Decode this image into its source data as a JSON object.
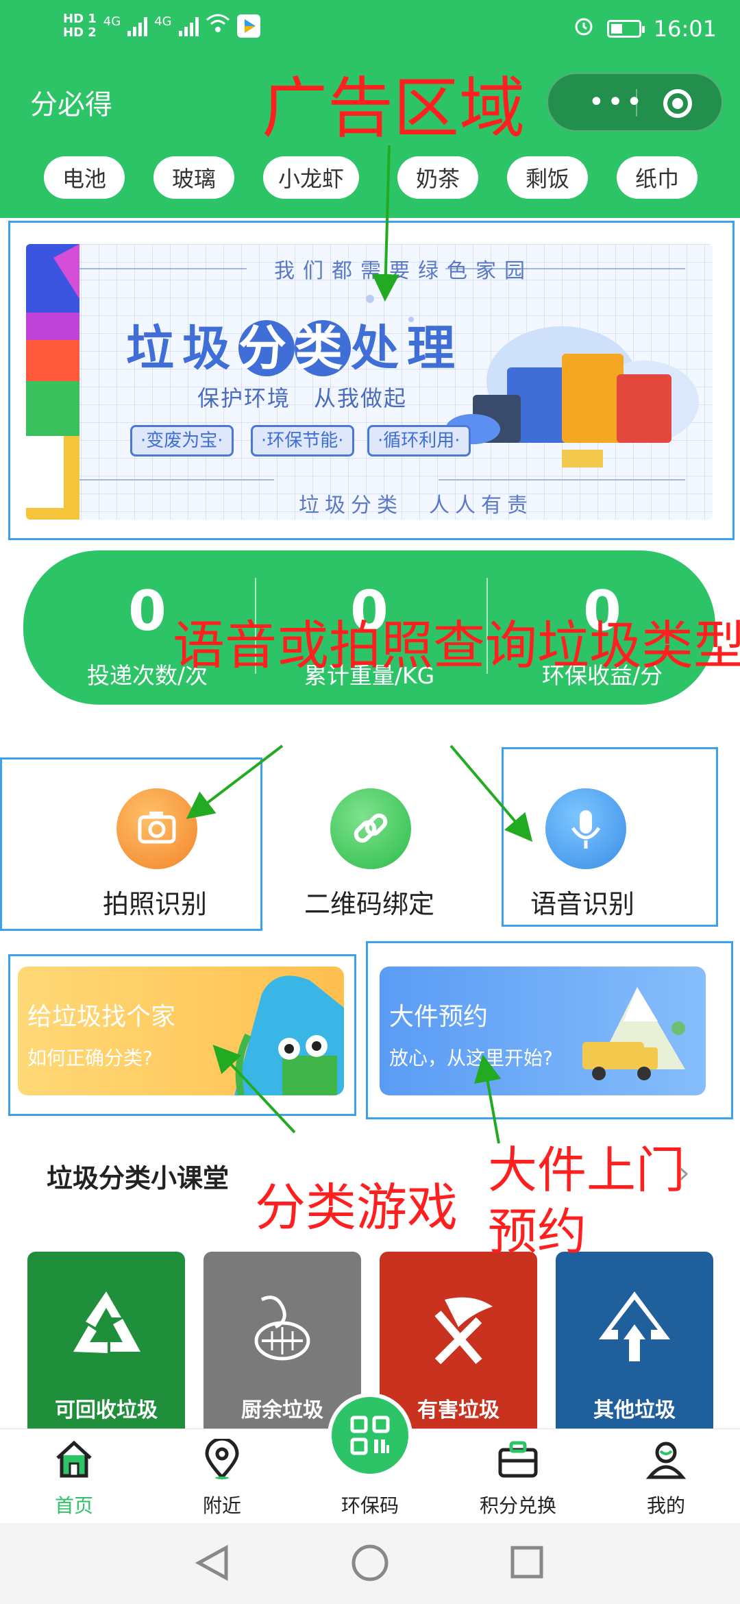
{
  "status_bar": {
    "hd1": "HD 1",
    "hd2": "HD 2",
    "net1": "4G",
    "net2": "4G",
    "time": "16:01"
  },
  "header": {
    "app_title": "分必得",
    "menu_dots": "•••"
  },
  "search_chips": [
    "电池",
    "玻璃",
    "小龙虾",
    "奶茶",
    "剩饭",
    "纸巾"
  ],
  "banner": {
    "top_line": "我们都需要绿色家园",
    "title_a": "垃圾",
    "title_hl1": "分",
    "title_hl2": "类",
    "title_b": "处理",
    "subtitle": "保护环境　从我做起",
    "tags": [
      "·变废为宝·",
      "·环保节能·",
      "·循环利用·"
    ],
    "footer": "垃圾分类　人人有责"
  },
  "stats": [
    {
      "value": "0",
      "label": "投递次数/次"
    },
    {
      "value": "0",
      "label": "累计重量/KG"
    },
    {
      "value": "0",
      "label": "环保收益/分"
    }
  ],
  "tools": [
    {
      "label": "拍照识别",
      "icon": "camera-icon"
    },
    {
      "label": "二维码绑定",
      "icon": "link-icon"
    },
    {
      "label": "语音识别",
      "icon": "microphone-icon"
    }
  ],
  "cards": [
    {
      "title": "给垃圾找个家",
      "subtitle": "如何正确分类?"
    },
    {
      "title": "大件预约",
      "subtitle": "放心，从这里开始?"
    }
  ],
  "course": {
    "title": "垃圾分类小课堂",
    "categories": [
      {
        "label": "可回收垃圾",
        "color": "#1f8f3c",
        "icon": "recycle-icon"
      },
      {
        "label": "厨余垃圾",
        "color": "#7a7a7a",
        "icon": "food-waste-icon"
      },
      {
        "label": "有害垃圾",
        "color": "#c8321e",
        "icon": "hazardous-icon"
      },
      {
        "label": "其他垃圾",
        "color": "#1f5f9c",
        "icon": "other-waste-icon"
      }
    ]
  },
  "tabbar": [
    {
      "label": "首页",
      "icon": "home-icon",
      "active": true
    },
    {
      "label": "附近",
      "icon": "location-icon",
      "active": false
    },
    {
      "label": "环保码",
      "icon": "qrcode-icon",
      "active": false
    },
    {
      "label": "积分兑换",
      "icon": "briefcase-icon",
      "active": false
    },
    {
      "label": "我的",
      "icon": "profile-icon",
      "active": false
    }
  ],
  "annotations": {
    "ad_area": "广告区域",
    "query": "语音或拍照查询垃圾类型",
    "game": "分类游戏",
    "booking_line1": "大件上门",
    "booking_line2": "预约"
  },
  "colors": {
    "brand_green": "#2dc468",
    "annotation_red": "#ff1f1f",
    "box_blue": "#3aa0f0",
    "arrow_green": "#22aa22"
  }
}
